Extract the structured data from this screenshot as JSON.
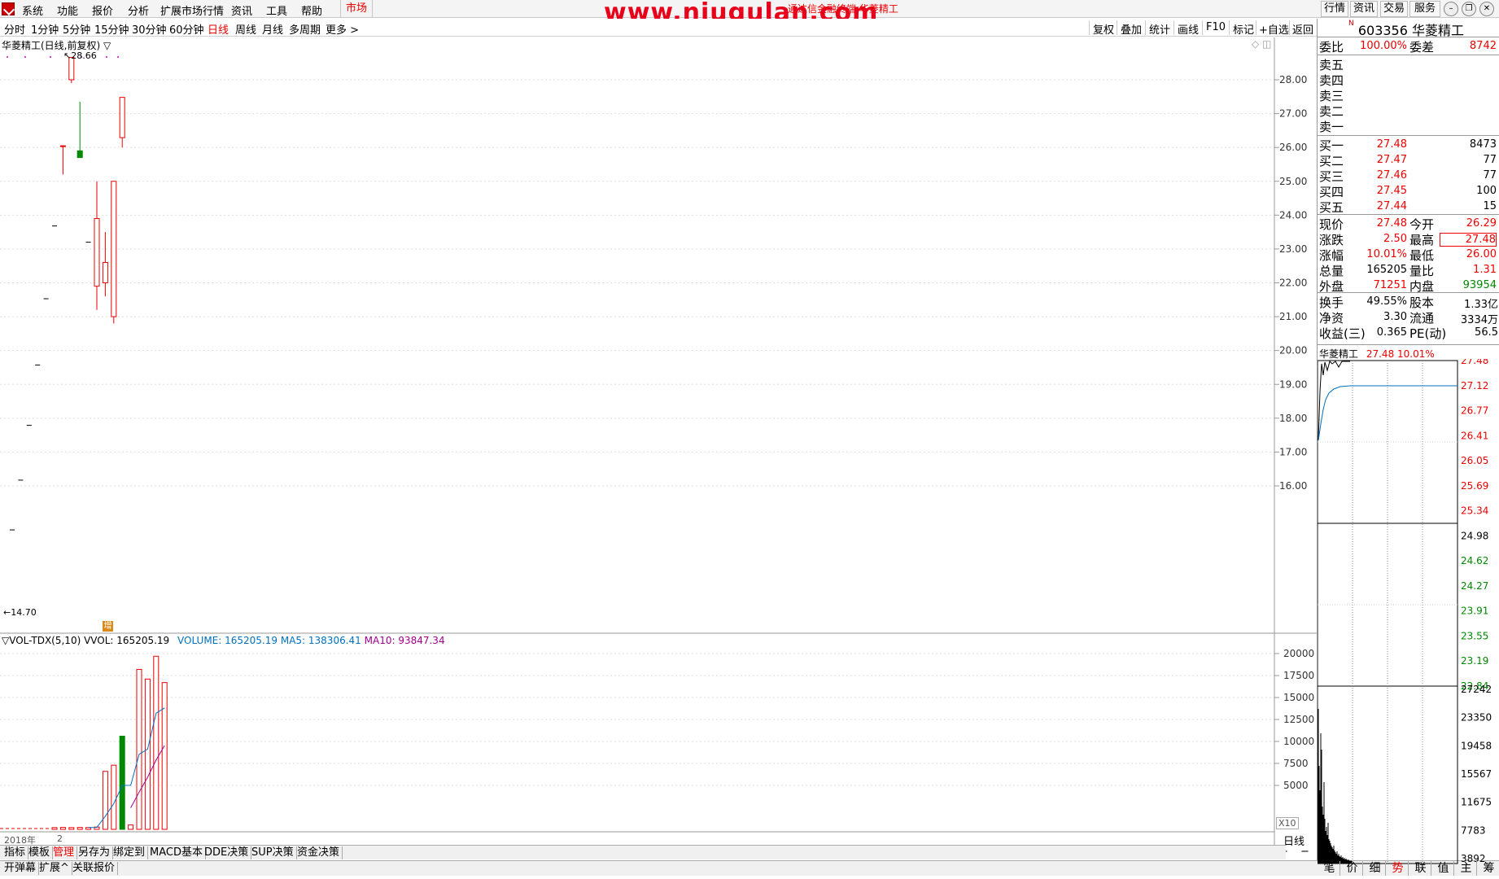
{
  "menubar": {
    "items": [
      "系统",
      "功能",
      "报价",
      "分析",
      "扩展市场行情",
      "资讯",
      "工具",
      "帮助"
    ],
    "market_tab": "市场",
    "watermark": "www.niugulan.com",
    "marquee": "通达信金融终端 华菱精工",
    "right_buttons": [
      "行情",
      "资讯",
      "交易",
      "服务"
    ]
  },
  "periods": [
    "分时",
    "1分钟",
    "5分钟",
    "15分钟",
    "30分钟",
    "60分钟",
    "日线",
    "周线",
    "月线",
    "多周期",
    "更多 >"
  ],
  "active_period": "日线",
  "tools": [
    "复权",
    "叠加",
    "统计",
    "画线",
    "F10",
    "标记",
    "+自选",
    "返回"
  ],
  "chart_title": "华菱精工(日线,前复权)",
  "price_max_label": "28.66",
  "price_min_label": "14.70",
  "event_marker": "增",
  "vol_indicator": {
    "name": "VOL-TDX(5,10)",
    "vvol": "VVOL: 165205.19",
    "volume": "VOLUME: 165205.19",
    "ma5": "MA5: 138306.41",
    "ma10": "MA10: 93847.34"
  },
  "x_axis": {
    "year": "2018年",
    "month": "2"
  },
  "chart_data": [
    {
      "type": "candlestick",
      "y_ticks": [
        16.0,
        17.0,
        18.0,
        19.0,
        20.0,
        21.0,
        22.0,
        23.0,
        24.0,
        25.0,
        26.0,
        27.0,
        28.0
      ],
      "candles": [
        {
          "o": 14.7,
          "h": 14.7,
          "l": 14.7,
          "c": 14.7
        },
        {
          "o": 16.17,
          "h": 16.17,
          "l": 16.17,
          "c": 16.17
        },
        {
          "o": 17.79,
          "h": 17.79,
          "l": 17.79,
          "c": 17.79
        },
        {
          "o": 19.57,
          "h": 19.57,
          "l": 19.57,
          "c": 19.57
        },
        {
          "o": 21.53,
          "h": 21.53,
          "l": 21.53,
          "c": 21.53
        },
        {
          "o": 23.68,
          "h": 23.68,
          "l": 23.68,
          "c": 23.68
        },
        {
          "o": 26.05,
          "h": 26.05,
          "l": 25.2,
          "c": 26.05
        },
        {
          "o": 28.0,
          "h": 28.66,
          "l": 27.9,
          "c": 28.66
        },
        {
          "o": 25.9,
          "h": 27.35,
          "l": 25.9,
          "c": 25.7
        },
        {
          "o": 23.2,
          "h": 23.2,
          "l": 23.2,
          "c": 23.2
        },
        {
          "o": 21.9,
          "h": 25.0,
          "l": 21.2,
          "c": 23.9
        },
        {
          "o": 22.0,
          "h": 23.5,
          "l": 21.6,
          "c": 22.6
        },
        {
          "o": 21.0,
          "h": 25.0,
          "l": 20.8,
          "c": 25.0
        },
        {
          "o": 26.29,
          "h": 27.48,
          "l": 26.0,
          "c": 27.48
        }
      ]
    },
    {
      "type": "bar",
      "title": "VOL-TDX(5,10)",
      "y_ticks": [
        5000,
        7500,
        10000,
        12500,
        15000,
        17500,
        20000
      ],
      "values": [
        200,
        220,
        200,
        220,
        210,
        260,
        6600,
        7300,
        10600,
        500,
        18200,
        17100,
        19700,
        16700
      ],
      "ma5": [
        null,
        null,
        null,
        null,
        210,
        222,
        1498,
        2928,
        4998,
        5016,
        8546,
        9122,
        13208,
        13818
      ],
      "ma10": [
        null,
        null,
        null,
        null,
        null,
        null,
        null,
        null,
        null,
        2442,
        4242,
        5930,
        7880,
        9536
      ]
    }
  ],
  "bottom_tabs": [
    "指标",
    "模板",
    "管理",
    "另存为",
    "绑定到",
    "MACD基本",
    "DDE决策",
    "SUP决策",
    "资金决策"
  ],
  "status_left": [
    "开弹幕",
    "扩展^",
    "关联报价"
  ],
  "right_corner": {
    "period": "日线",
    "x10": "X10"
  },
  "panel": {
    "code": "603356",
    "name": "华菱精工",
    "weibi_label": "委比",
    "weibi": "100.00%",
    "weicha_label": "委差",
    "weicha": "8742",
    "sells": [
      "卖五",
      "卖四",
      "卖三",
      "卖二",
      "卖一"
    ],
    "buys": [
      {
        "l": "买一",
        "p": "27.48",
        "v": "8473"
      },
      {
        "l": "买二",
        "p": "27.47",
        "v": "77"
      },
      {
        "l": "买三",
        "p": "27.46",
        "v": "77"
      },
      {
        "l": "买四",
        "p": "27.45",
        "v": "100"
      },
      {
        "l": "买五",
        "p": "27.44",
        "v": "15"
      }
    ],
    "quote": [
      {
        "l1": "现价",
        "v1": "27.48",
        "c1": "red",
        "l2": "今开",
        "v2": "26.29",
        "c2": "red"
      },
      {
        "l1": "涨跌",
        "v1": "2.50",
        "c1": "red",
        "l2": "最高",
        "v2": "27.48",
        "c2": "red"
      },
      {
        "l1": "涨幅",
        "v1": "10.01%",
        "c1": "red",
        "l2": "最低",
        "v2": "26.00",
        "c2": "red"
      },
      {
        "l1": "总量",
        "v1": "165205",
        "c1": "dark",
        "l2": "量比",
        "v2": "1.31",
        "c2": "red"
      },
      {
        "l1": "外盘",
        "v1": "71251",
        "c1": "red",
        "l2": "内盘",
        "v2": "93954",
        "c2": "green"
      }
    ],
    "fund": [
      {
        "l1": "换手",
        "v1": "49.55%",
        "l2": "股本",
        "v2": "1.33亿"
      },
      {
        "l1": "净资",
        "v1": "3.30",
        "l2": "流通",
        "v2": "3334万"
      },
      {
        "l1": "收益(三)",
        "v1": "0.365",
        "l2": "PE(动)",
        "v2": "56.5"
      }
    ],
    "mini_title": "华菱精工",
    "mini_price": "27.48",
    "mini_pct": "10.01%",
    "mini_price_ticks": [
      {
        "v": "27.48",
        "c": "red"
      },
      {
        "v": "27.12",
        "c": "red"
      },
      {
        "v": "26.77",
        "c": "red"
      },
      {
        "v": "26.41",
        "c": "red"
      },
      {
        "v": "26.05",
        "c": "red"
      },
      {
        "v": "25.69",
        "c": "red"
      },
      {
        "v": "25.34",
        "c": "red"
      },
      {
        "v": "24.98",
        "c": "dark"
      },
      {
        "v": "24.62",
        "c": "green"
      },
      {
        "v": "24.27",
        "c": "green"
      },
      {
        "v": "23.91",
        "c": "green"
      },
      {
        "v": "23.55",
        "c": "green"
      },
      {
        "v": "23.19",
        "c": "green"
      },
      {
        "v": "22.84",
        "c": "green"
      }
    ],
    "mini_vol_ticks": [
      "27242",
      "23350",
      "19458",
      "15567",
      "11675",
      "7783",
      "3892"
    ],
    "tabs": [
      "笔",
      "价",
      "细",
      "势",
      "联",
      "值",
      "主",
      "筹"
    ],
    "active_tab": "势"
  }
}
